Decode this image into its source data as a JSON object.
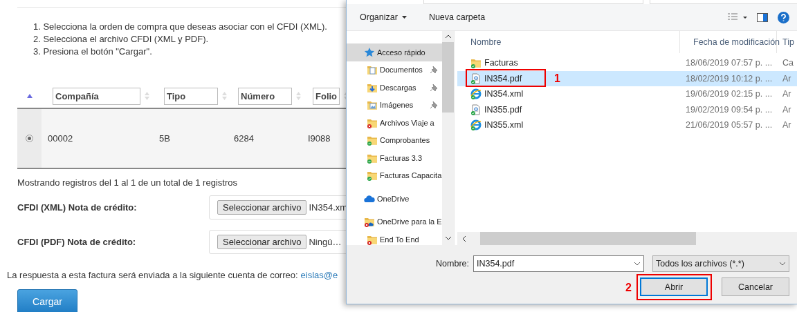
{
  "page": {
    "instructions": [
      "1. Selecciona la orden de compra que deseas asociar con el CFDI (XML).",
      "2. Selecciona el archivo CFDI (XML y PDF).",
      "3. Presiona el botón \"Cargar\"."
    ],
    "table": {
      "selector_sorted": true,
      "columns": [
        {
          "label": "Compañía"
        },
        {
          "label": "Tipo"
        },
        {
          "label": "Número"
        },
        {
          "label": "Folio"
        }
      ],
      "rows": [
        {
          "selected": true,
          "cells": [
            "00002",
            "5B",
            "6284",
            "I9088"
          ]
        }
      ]
    },
    "summary": "Mostrando registros del 1 al 1 de un total de 1 registros",
    "upload_fields": [
      {
        "label": "CFDI (XML) Nota de crédito:",
        "button": "Seleccionar archivo",
        "file": "IN354.xm"
      },
      {
        "label": "CFDI (PDF) Nota de crédito:",
        "button": "Seleccionar archivo",
        "file": "Ningú…"
      }
    ],
    "notice": {
      "text": "La respuesta a esta factura será enviada a la siguiente cuenta de correo:",
      "email": "eislas@e"
    },
    "submit": "Cargar"
  },
  "dialog": {
    "toolbar": {
      "organize": "Organizar",
      "new_folder": "Nueva carpeta"
    },
    "nav": [
      {
        "label": "Acceso rápido",
        "kind": "star",
        "selected": true,
        "children": [
          {
            "label": "Documentos",
            "kind": "docs-folder",
            "pinned": true,
            "selected": false
          },
          {
            "label": "Descargas",
            "kind": "downloads-folder",
            "pinned": true,
            "selected": false
          },
          {
            "label": "Imágenes",
            "kind": "images-folder",
            "pinned": true,
            "selected": false
          },
          {
            "label": "Archivos Viaje a",
            "kind": "folder-error",
            "selected": false
          },
          {
            "label": "Comprobantes",
            "kind": "folder-synced",
            "selected": false
          },
          {
            "label": "Facturas 3.3",
            "kind": "folder-synced",
            "selected": false
          },
          {
            "label": "Facturas Capacita",
            "kind": "folder-synced",
            "selected": false
          }
        ]
      },
      {
        "label": "OneDrive",
        "kind": "cloud",
        "selected": false
      },
      {
        "label": "OneDrive para la E",
        "kind": "business-folder-error",
        "selected": false,
        "children": [
          {
            "label": "End To End",
            "kind": "folder-error",
            "selected": false
          }
        ]
      }
    ],
    "columns": [
      "Nombre",
      "Fecha de modificación",
      "Tip"
    ],
    "files": [
      {
        "name": "Facturas",
        "date": "18/06/2019 07:57 p. ...",
        "type": "Ca",
        "kind": "folder",
        "selected": false
      },
      {
        "name": "IN354.pdf",
        "date": "18/02/2019 10:12 p. ...",
        "type": "Ar",
        "kind": "pdf",
        "selected": true,
        "callout": "1"
      },
      {
        "name": "IN354.xml",
        "date": "19/06/2019 02:15 p. ...",
        "type": "Ar",
        "kind": "xml",
        "selected": false
      },
      {
        "name": "IN355.pdf",
        "date": "19/02/2019 09:54 p. ...",
        "type": "Ar",
        "kind": "pdf",
        "selected": false
      },
      {
        "name": "IN355.xml",
        "date": "21/06/2019 05:57 p. ...",
        "type": "Ar",
        "kind": "xml",
        "selected": false
      }
    ],
    "filename": {
      "label": "Nombre:",
      "value": "IN354.pdf"
    },
    "filter": "Todos los archivos (*.*)",
    "buttons": [
      {
        "label": "Abrir",
        "default": true,
        "callout": "2"
      },
      {
        "label": "Cancelar",
        "default": false
      }
    ]
  }
}
